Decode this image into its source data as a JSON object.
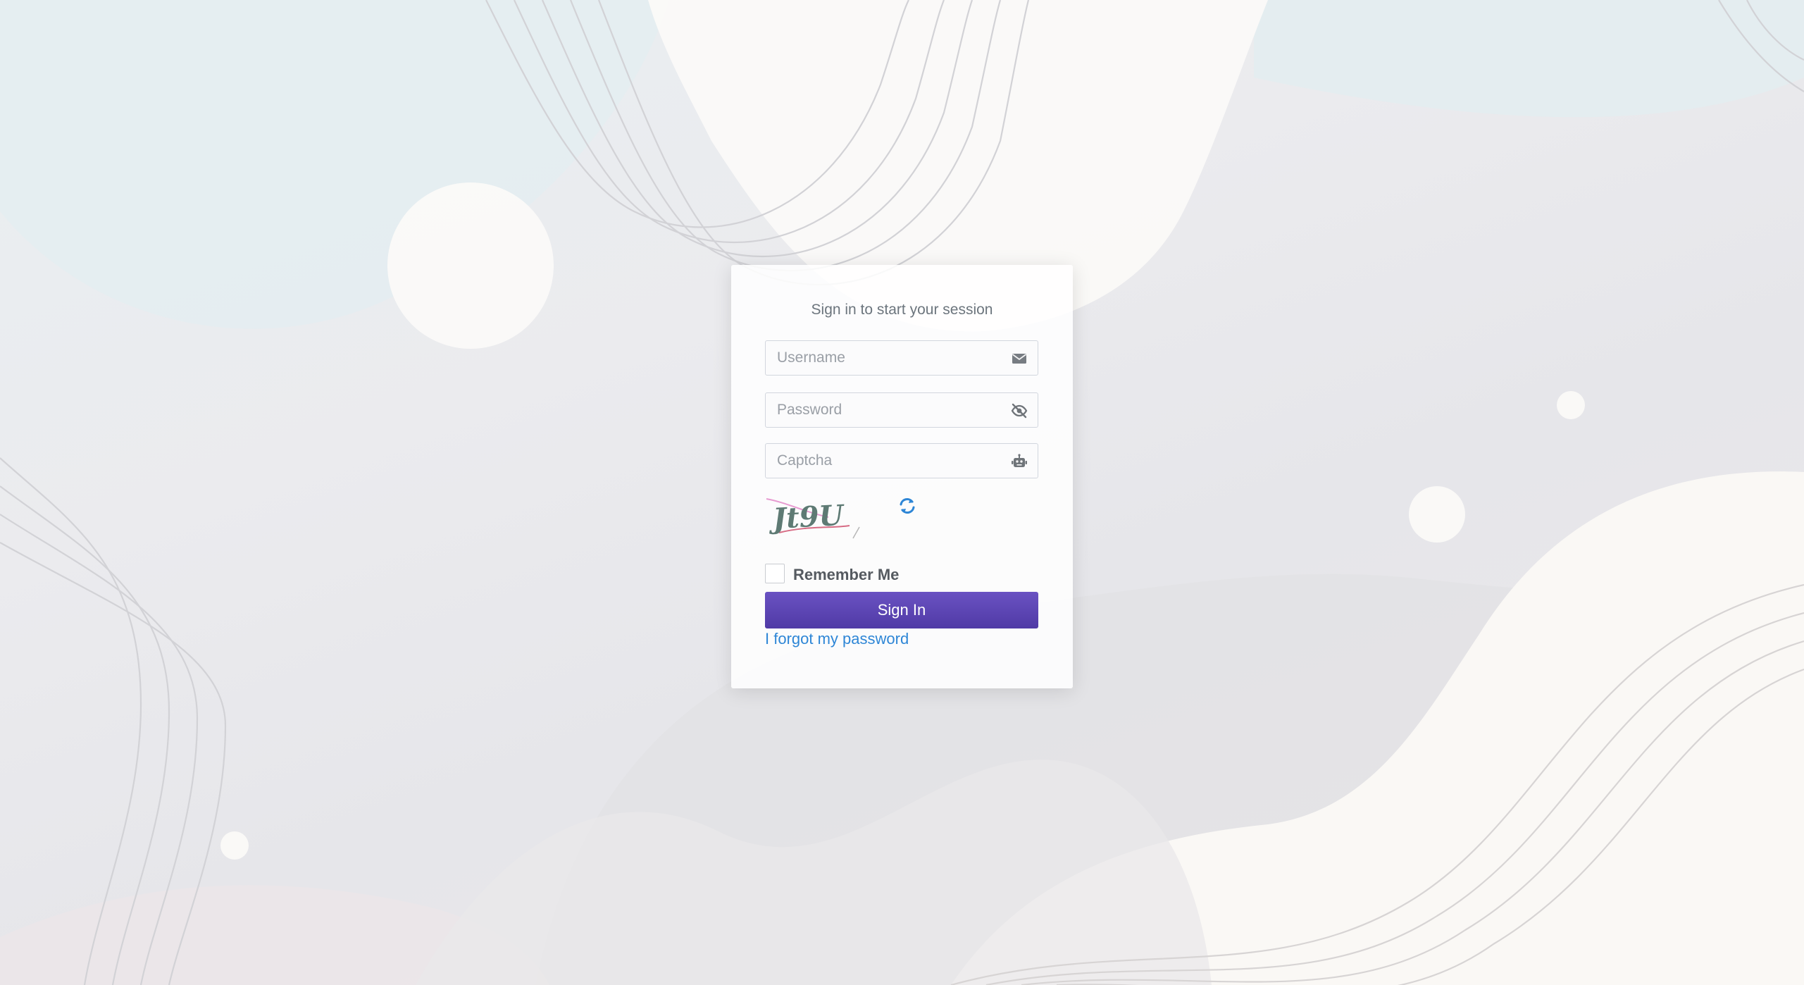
{
  "login": {
    "message": "Sign in to start your session",
    "username_placeholder": "Username",
    "password_placeholder": "Password",
    "captcha_placeholder": "Captcha",
    "captcha_text": "Jt9U",
    "remember_label": "Remember Me",
    "remember_checked": false,
    "signin_label": "Sign In",
    "forgot_label": "I forgot my password"
  },
  "icons": {
    "username": "envelope-icon",
    "password": "eye-slash-icon",
    "captcha": "robot-icon",
    "refresh": "refresh-icon"
  },
  "colors": {
    "primary_button": "#5a43b4",
    "link": "#2e86d6",
    "refresh_icon": "#2e86d6"
  }
}
